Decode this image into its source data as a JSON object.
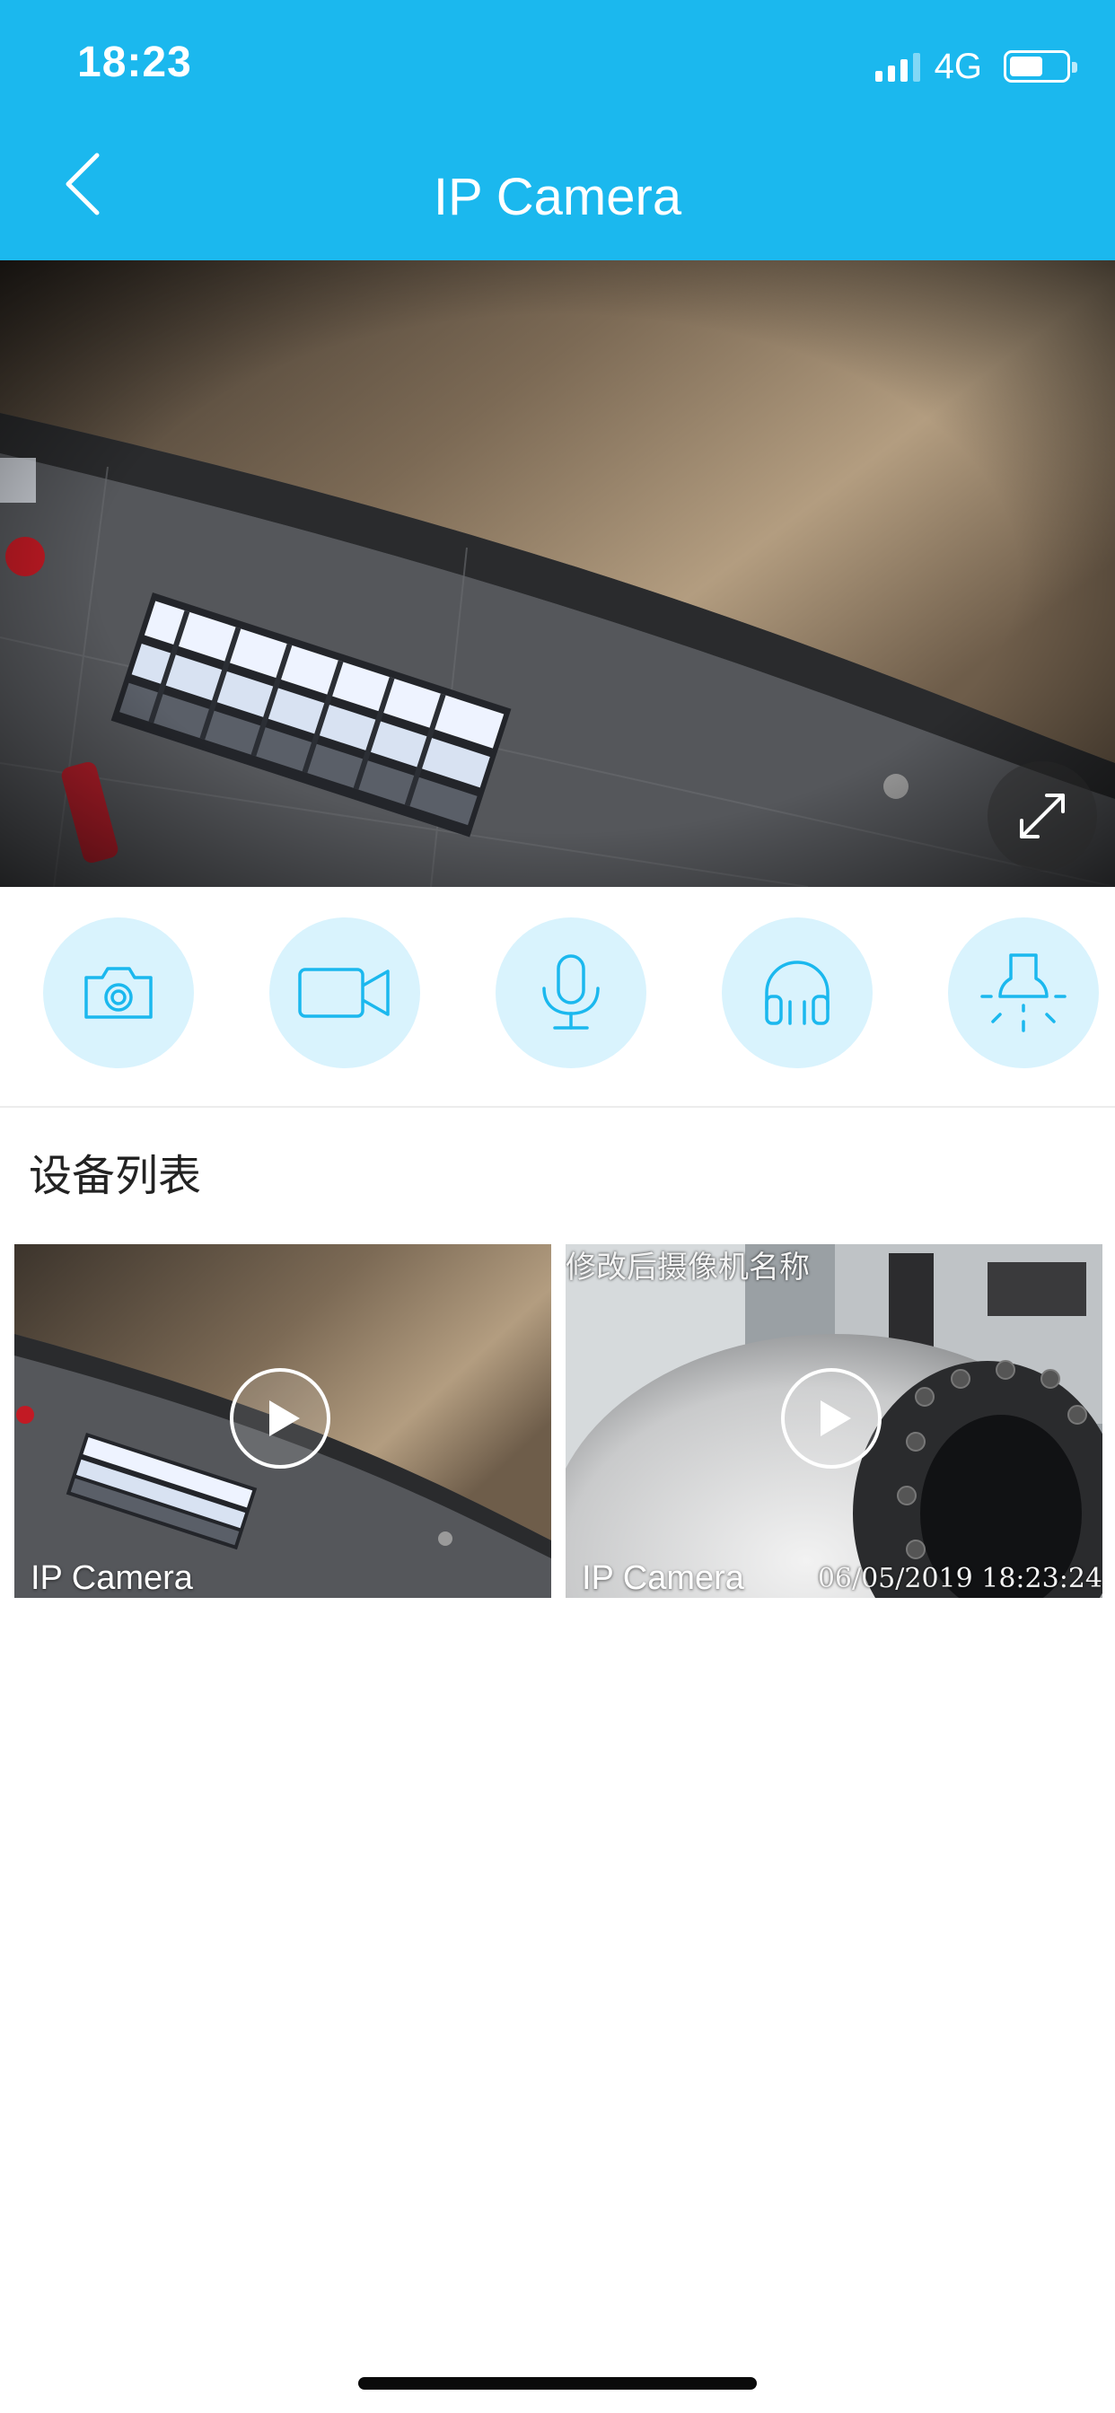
{
  "status_bar": {
    "time": "18:23",
    "network": "4G",
    "battery_level": 0.6
  },
  "header": {
    "title": "IP Camera",
    "back_icon": "chevron-left-icon",
    "bg_color": "#1bb8ee"
  },
  "live_view": {
    "fullscreen_icon": "expand-icon"
  },
  "controls": [
    {
      "name": "snapshot",
      "icon": "camera-icon"
    },
    {
      "name": "record",
      "icon": "video-icon"
    },
    {
      "name": "talk",
      "icon": "microphone-icon"
    },
    {
      "name": "listen",
      "icon": "headphones-icon"
    },
    {
      "name": "light",
      "icon": "light-bulb-icon"
    }
  ],
  "device_list": {
    "title": "设备列表",
    "devices": [
      {
        "name": "IP Camera"
      },
      {
        "name": "IP Camera",
        "osd_name": "修改后摄像机名称",
        "osd_time": "06/05/2019 18:23:24"
      }
    ]
  }
}
